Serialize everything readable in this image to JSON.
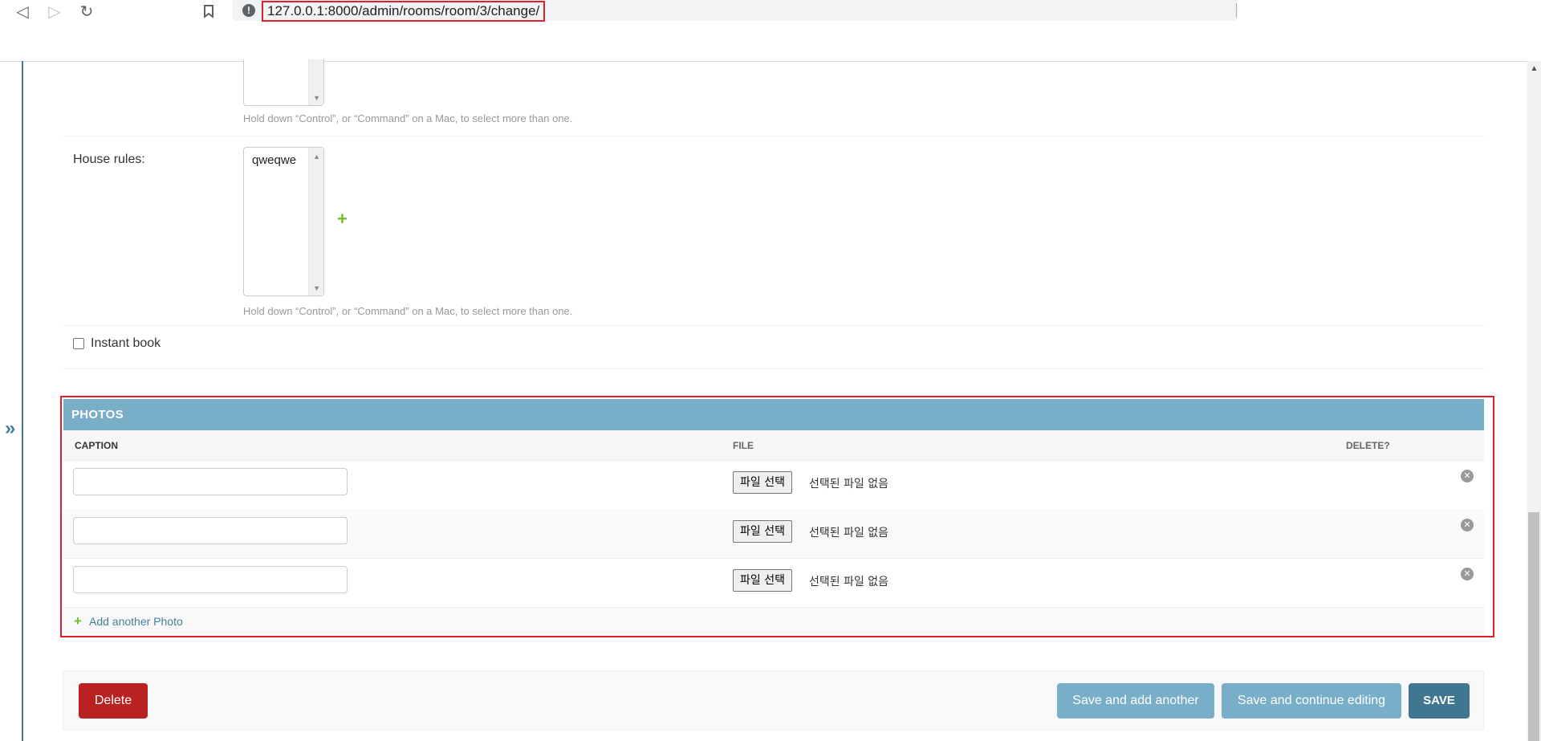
{
  "browser": {
    "url": "127.0.0.1:8000/admin/rooms/room/3/change/"
  },
  "fields": {
    "top_select_help": "Hold down “Control”, or “Command” on a Mac, to select more than one.",
    "house_rules": {
      "label": "House rules:",
      "selected_option": "qweqwe",
      "help": "Hold down “Control”, or “Command” on a Mac, to select more than one."
    },
    "instant_book": {
      "label": "Instant book",
      "checked": false
    }
  },
  "photos_inline": {
    "title": "PHOTOS",
    "columns": {
      "caption": "CAPTION",
      "file": "FILE",
      "delete": "DELETE?"
    },
    "rows": [
      {
        "caption": "",
        "file_button": "파일 선택",
        "file_status": "선택된 파일 없음"
      },
      {
        "caption": "",
        "file_button": "파일 선택",
        "file_status": "선택된 파일 없음"
      },
      {
        "caption": "",
        "file_button": "파일 선택",
        "file_status": "선택된 파일 없음"
      }
    ],
    "add_another": "Add another Photo"
  },
  "submit_row": {
    "delete": "Delete",
    "save_add_another": "Save and add another",
    "save_continue": "Save and continue editing",
    "save": "SAVE"
  },
  "colors": {
    "admin_header": "#79aec8",
    "admin_primary": "#417690",
    "delete_red": "#ba2121",
    "add_green": "#70bf2b",
    "link_blue": "#447e9b",
    "highlight_red": "#e0202a"
  }
}
